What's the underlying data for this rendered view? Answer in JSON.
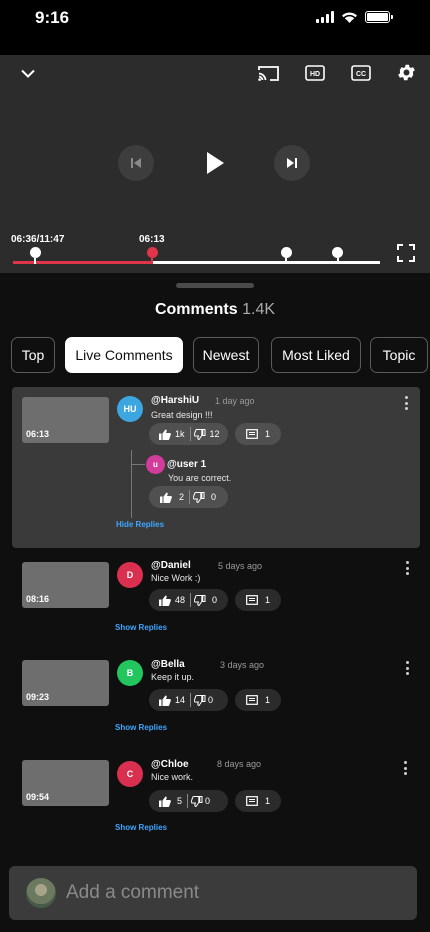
{
  "status_bar": {
    "time": "9:16"
  },
  "player": {
    "current_time": "06:36/11:47",
    "marker_time": "06:13",
    "progress_fraction": 0.38,
    "markers": [
      {
        "name": "marker-current",
        "fraction": 0.06,
        "color": "#ffffff"
      },
      {
        "name": "marker-highlight",
        "fraction": 0.38,
        "color": "#e0344b"
      },
      {
        "name": "marker-2",
        "fraction": 0.745,
        "color": "#ffffff"
      },
      {
        "name": "marker-3",
        "fraction": 0.885,
        "color": "#ffffff"
      }
    ],
    "icons": [
      "chevron-down-icon",
      "cast-icon",
      "hd-icon",
      "cc-icon",
      "gear-icon",
      "previous-icon",
      "play-icon",
      "next-icon",
      "fullscreen-icon"
    ]
  },
  "comments_header": {
    "title": "Comments",
    "count": "1.4K"
  },
  "tabs": [
    {
      "label": "Top",
      "active": false
    },
    {
      "label": "Live Comments",
      "active": true
    },
    {
      "label": "Newest",
      "active": false
    },
    {
      "label": "Most Liked",
      "active": false
    },
    {
      "label": "Topic",
      "active": false
    }
  ],
  "comments": [
    {
      "thumb_time": "06:13",
      "initials": "HU",
      "avatar_color": "#3ca6e0",
      "author": "@HarshiU",
      "when": "1 day ago",
      "text": "Great design !!!",
      "likes": "1k",
      "dislikes": "12",
      "replies": "1",
      "replies_link": "Hide Replies",
      "reply": {
        "initials": "u",
        "avatar_color": "#d23c9a",
        "author": "@user 1",
        "text": "You are correct.",
        "likes": "2",
        "dislikes": "0"
      }
    },
    {
      "thumb_time": "08:16",
      "initials": "D",
      "avatar_color": "#d9304f",
      "author": "@Daniel",
      "when": "5 days ago",
      "text": "Nice Work :)",
      "likes": "48",
      "dislikes": "0",
      "replies": "1",
      "replies_link": "Show Replies"
    },
    {
      "thumb_time": "09:23",
      "initials": "B",
      "avatar_color": "#22c55e",
      "author": "@Bella",
      "when": "3 days ago",
      "text": "Keep it up.",
      "likes": "14",
      "dislikes": "0",
      "replies": "1",
      "replies_link": "Show Replies"
    },
    {
      "thumb_time": "09:54",
      "initials": "C",
      "avatar_color": "#d9304f",
      "author": "@Chloe",
      "when": "8 days ago",
      "text": "Nice work.",
      "likes": "5",
      "dislikes": "0",
      "replies": "1",
      "replies_link": "Show Replies"
    }
  ],
  "add_comment": {
    "placeholder": "Add a comment"
  }
}
